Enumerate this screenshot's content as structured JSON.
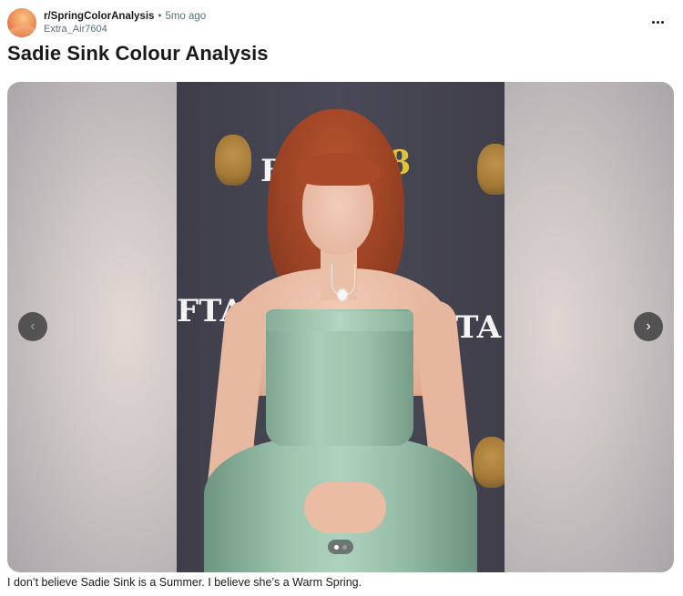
{
  "post": {
    "subreddit": "r/SpringColorAnalysis",
    "separator": "•",
    "time_ago": "5mo ago",
    "author": "Extra_Air7604",
    "title": "Sadie Sink Colour Analysis",
    "body": "I don’t believe Sadie Sink is a Summer. I believe she’s a Warm Spring."
  },
  "icons": {
    "more": "more-options-icon",
    "prev": "chevron-left-icon",
    "next": "chevron-right-icon",
    "avatar": "subreddit-avatar"
  },
  "gallery": {
    "total_images": 2,
    "current_index": 1,
    "prev_glyph": "‹",
    "next_glyph": "›",
    "background_text": {
      "logo_left": "B",
      "logo_right": "8",
      "text_left": "FTA",
      "text_right": "FTA"
    }
  },
  "colors": {
    "title_text": "#1a1a1b",
    "meta_text": "#576f76",
    "dress": "#9cc3ad",
    "hair": "#a9492a"
  }
}
